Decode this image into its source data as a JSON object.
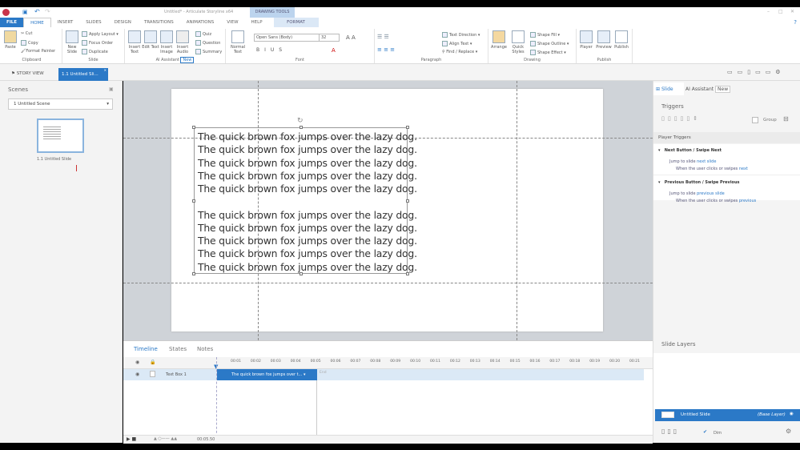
{
  "window": {
    "title": "Untitled* - Articulate Storyline x64",
    "context_tab": "DRAWING TOOLS"
  },
  "ribbon_tabs": [
    "FILE",
    "HOME",
    "INSERT",
    "SLIDES",
    "DESIGN",
    "TRANSITIONS",
    "ANIMATIONS",
    "VIEW",
    "HELP",
    "FORMAT"
  ],
  "clipboard": {
    "paste": "Paste",
    "cut": "Cut",
    "copy": "Copy",
    "format_painter": "Format Painter",
    "label": "Clipboard"
  },
  "slide_grp": {
    "new_slide": "New Slide",
    "apply_layout": "Apply Layout",
    "focus_order": "Focus Order",
    "duplicate": "Duplicate",
    "label": "Slide"
  },
  "ai": {
    "insert_text": "Insert Text",
    "edit_text": "Edit Text",
    "insert_image": "Insert Image",
    "insert_audio": "Insert Audio",
    "quiz": "Quiz",
    "question": "Question",
    "summary": "Summary",
    "label": "AI Assistant",
    "badge": "New"
  },
  "font": {
    "normal_text": "Normal Text",
    "family": "Open Sans (Body)",
    "size": "32",
    "label": "Font"
  },
  "paragraph": {
    "text_direction": "Text Direction",
    "align_text": "Align Text",
    "find_replace": "Find / Replace",
    "label": "Paragraph"
  },
  "drawing": {
    "arrange": "Arrange",
    "quick_styles": "Quick Styles",
    "shape_fill": "Shape Fill",
    "shape_outline": "Shape Outline",
    "shape_effect": "Shape Effect",
    "label": "Drawing"
  },
  "publish": {
    "player": "Player",
    "preview": "Preview",
    "publish": "Publish",
    "label": "Publish"
  },
  "view_tabs": {
    "story_view": "STORY VIEW",
    "slide_tab": "1.1 Untitled Sli..."
  },
  "scenes": {
    "title": "Scenes",
    "selected": "1 Untitled Scene",
    "slide_label": "1.1 Untitled Slide"
  },
  "textbox": {
    "lines": [
      "The quick brown fox jumps over the lazy dog.",
      "The quick brown fox jumps over the lazy dog.",
      "The quick brown fox jumps over the lazy dog.",
      "The quick brown fox jumps over the lazy dog.",
      "The quick brown fox jumps over the lazy dog.",
      "The quick brown fox jumps over the lazy dog.",
      "The quick brown fox jumps over the lazy dog.",
      "The quick brown fox jumps over the lazy dog.",
      "The quick brown fox jumps over the lazy dog.",
      "The quick brown fox jumps over the lazy dog."
    ]
  },
  "timeline": {
    "tabs": [
      "Timeline",
      "States",
      "Notes"
    ],
    "ticks": [
      "00:01",
      "00:02",
      "00:03",
      "00:04",
      "00:05",
      "00:06",
      "00:07",
      "00:08",
      "00:09",
      "00:10",
      "00:11",
      "00:12",
      "00:13",
      "00:14",
      "00:15",
      "00:16",
      "00:17",
      "00:18",
      "00:19",
      "00:20",
      "00:21"
    ],
    "layer": "Text Box 1",
    "bar_label": "The quick brown fox jumps over t...",
    "end_label": "End",
    "time": "00:05.50"
  },
  "right": {
    "tab_slide": "Slide",
    "tab_ai": "AI Assistant",
    "ai_badge": "New",
    "triggers": "Triggers",
    "group": "Group",
    "player_triggers": "Player Triggers",
    "trig1": {
      "title": "Next Button / Swipe Next",
      "action_pre": "Jump to slide ",
      "action_link": "next slide",
      "when_pre": "When the user clicks or swipes ",
      "when_link": "next"
    },
    "trig2": {
      "title": "Previous Button / Swipe Previous",
      "action_pre": "Jump to slide ",
      "action_link": "previous slide",
      "when_pre": "When the user clicks or swipes ",
      "when_link": "previous"
    },
    "layers": "Slide Layers",
    "layer_name": "Untitled Slide",
    "base_layer": "(Base Layer)",
    "dim": "Dim"
  },
  "colors": {
    "accent": "#2b79c7"
  }
}
